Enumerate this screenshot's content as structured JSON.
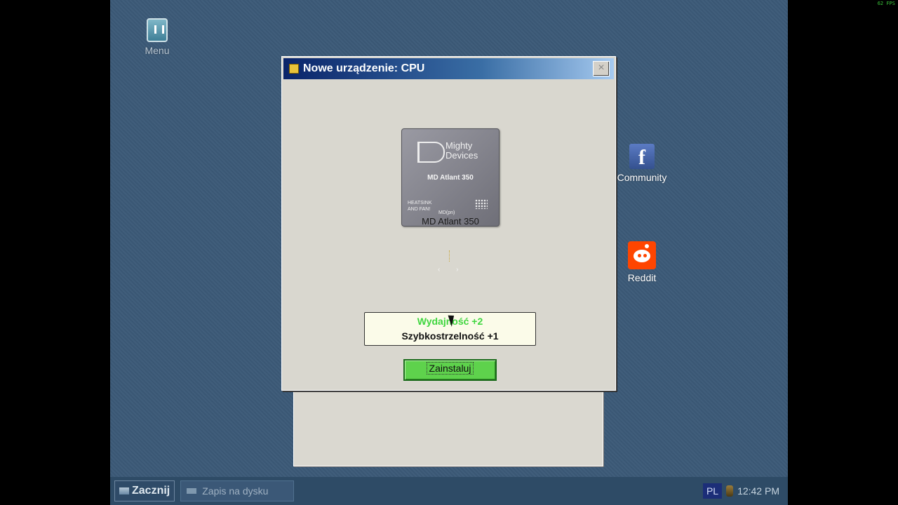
{
  "overlay": {
    "fps": "62 FPS"
  },
  "desktop": {
    "icons": [
      {
        "label": "Menu",
        "icon": "menu-icon"
      },
      {
        "label": "Community",
        "icon": "facebook-icon"
      },
      {
        "label": "Reddit",
        "icon": "reddit-icon"
      }
    ]
  },
  "dialog": {
    "title": "Nowe urządzenie: CPU",
    "close_glyph": "×",
    "card": {
      "brand_line1": "Mighty",
      "brand_line2": "Devices",
      "model": "MD Atlant 350",
      "small_line1": "HEATSINK",
      "small_line2": "AND FAN!",
      "small_line3": "MD(pn)",
      "name_label": "MD Atlant 350"
    },
    "arrows": "‹ ›",
    "stats": {
      "line1": "Wydajność  +2",
      "line2": "Szybkostrzelność  +1"
    },
    "install_label": "Zainstaluj"
  },
  "taskbar": {
    "start_label": "Zacznij",
    "task_label": "Zapis na dysku",
    "language": "PL",
    "clock": "12:42 PM"
  }
}
